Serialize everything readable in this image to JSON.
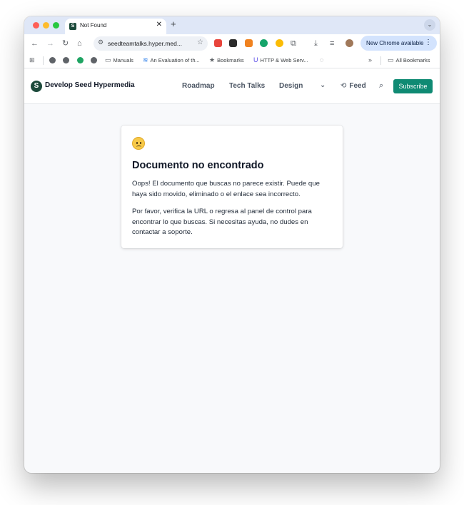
{
  "browser": {
    "tab": {
      "title": "Not Found",
      "favicon": "S"
    },
    "new_tab": "+",
    "omnibox": {
      "url": "seedteamtalks.hyper.med..."
    },
    "update_button": "New Chrome available",
    "bookmarks": {
      "manuals": "Manuals",
      "evaluation": "An Evaluation of th...",
      "bookmarks": "Bookmarks",
      "http": "HTTP & Web Serv...",
      "all": "All Bookmarks"
    }
  },
  "site": {
    "logo_letter": "S",
    "name": "Develop Seed Hypermedia",
    "nav": {
      "roadmap": "Roadmap",
      "tech_talks": "Tech Talks",
      "design": "Design",
      "feed": "Feed"
    },
    "subscribe": "Subscribe"
  },
  "error": {
    "title": "Documento no encontrado",
    "p1": "Oops! El documento que buscas no parece existir. Puede que haya sido movido, eliminado o el enlace sea incorrecto.",
    "p2": "Por favor, verifica la URL o regresa al panel de control para encontrar lo que buscas. Si necesitas ayuda, no dudes en contactar a soporte."
  },
  "colors": {
    "accent": "#0f8a73",
    "logo": "#1c4a3b",
    "page_bg": "#f8f9fb"
  },
  "icons": [
    "sad-face-icon",
    "search-icon",
    "history-icon",
    "chevron-down-icon",
    "star-icon"
  ]
}
